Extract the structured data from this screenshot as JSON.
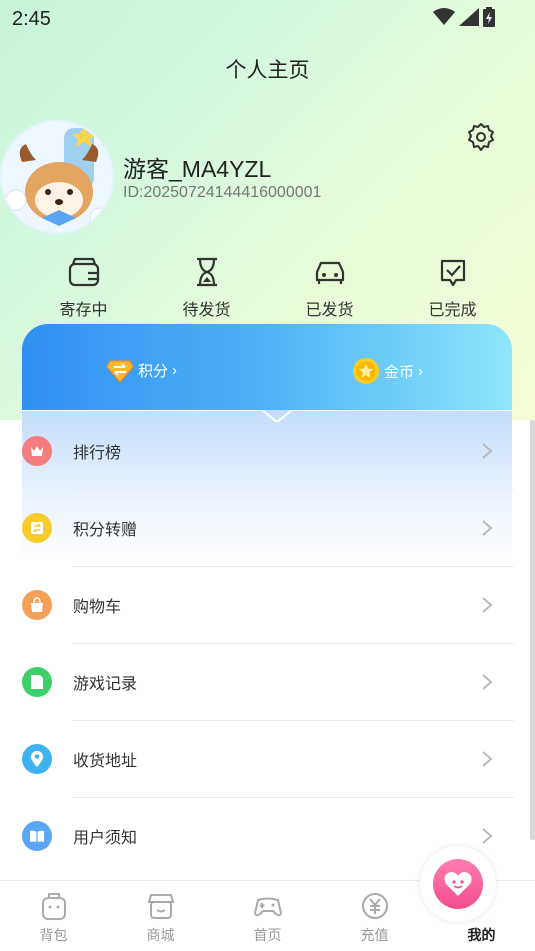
{
  "status_bar": {
    "time": "2:45"
  },
  "header": {
    "title": "个人主页"
  },
  "profile": {
    "username": "游客_MA4YZL",
    "user_id": "ID:20250724144416000001"
  },
  "orders": [
    {
      "label": "寄存中",
      "icon": "wallet-icon"
    },
    {
      "label": "待发货",
      "icon": "hourglass-icon"
    },
    {
      "label": "已发货",
      "icon": "delivery-car-icon"
    },
    {
      "label": "已完成",
      "icon": "completed-icon"
    }
  ],
  "points_card": {
    "points_label": "积分",
    "coins_label": "金币"
  },
  "menu": [
    {
      "label": "排行榜",
      "icon": "crown-icon",
      "color": "#f47c7c"
    },
    {
      "label": "积分转赠",
      "icon": "transfer-icon",
      "color": "#f7cc2b"
    },
    {
      "label": "购物车",
      "icon": "shopping-bag-icon",
      "color": "#f5a05a"
    },
    {
      "label": "游戏记录",
      "icon": "record-icon",
      "color": "#3ecf6a"
    },
    {
      "label": "收货地址",
      "icon": "location-pin-icon",
      "color": "#3fb3f0"
    },
    {
      "label": "用户须知",
      "icon": "book-icon",
      "color": "#5aa6f2"
    }
  ],
  "tabbar": [
    {
      "label": "背包",
      "icon": "backpack-icon"
    },
    {
      "label": "商城",
      "icon": "store-icon"
    },
    {
      "label": "首页",
      "icon": "gamepad-icon"
    },
    {
      "label": "充值",
      "icon": "yuan-icon"
    },
    {
      "label": "我的",
      "icon": "heart-face-icon",
      "active": true
    }
  ]
}
